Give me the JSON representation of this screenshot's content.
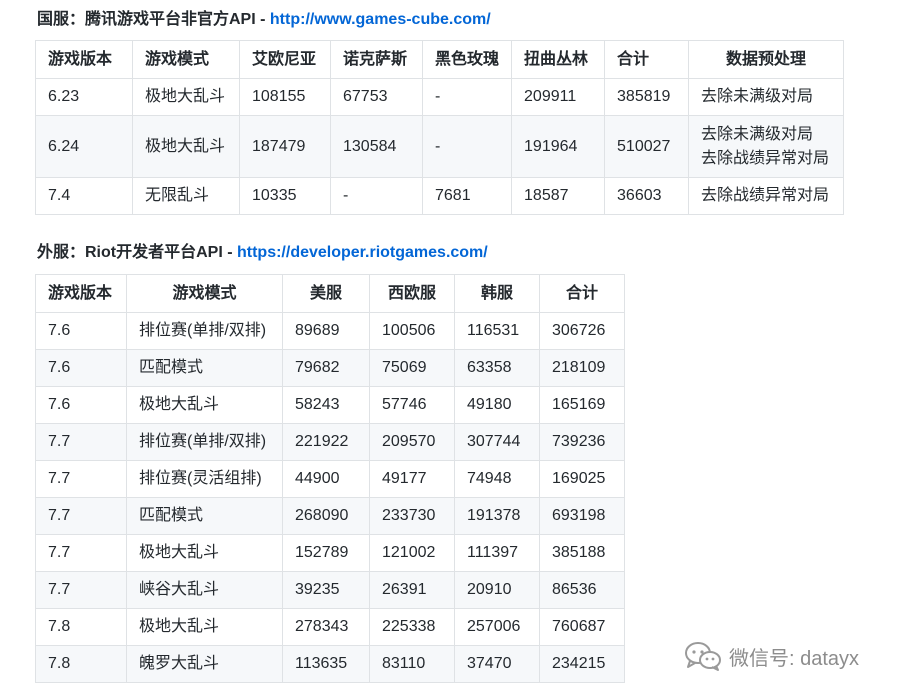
{
  "section1": {
    "label": "国服：腾讯游戏平台非官方API - ",
    "link": "http://www.games-cube.com/",
    "headers": [
      "游戏版本",
      "游戏模式",
      "艾欧尼亚",
      "诺克萨斯",
      "黑色玫瑰",
      "扭曲丛林",
      "合计",
      "数据预处理"
    ],
    "rows": [
      {
        "ver": "6.23",
        "mode": "极地大乱斗",
        "a": "108155",
        "b": "67753",
        "c": "-",
        "d": "209911",
        "e": "385819",
        "f1": "去除未满级对局",
        "f2": ""
      },
      {
        "ver": "6.24",
        "mode": "极地大乱斗",
        "a": "187479",
        "b": "130584",
        "c": "-",
        "d": "191964",
        "e": "510027",
        "f1": "去除未满级对局",
        "f2": "去除战绩异常对局"
      },
      {
        "ver": "7.4",
        "mode": "无限乱斗",
        "a": "10335",
        "b": "-",
        "c": "7681",
        "d": "18587",
        "e": "36603",
        "f1": "去除战绩异常对局",
        "f2": ""
      }
    ]
  },
  "section2": {
    "label": "外服：Riot开发者平台API - ",
    "link": "https://developer.riotgames.com/",
    "headers": [
      "游戏版本",
      "游戏模式",
      "美服",
      "西欧服",
      "韩服",
      "合计"
    ],
    "rows": [
      {
        "ver": "7.6",
        "mode": "排位赛(单排/双排)",
        "us": "89689",
        "eu": "100506",
        "kr": "116531",
        "tot": "306726"
      },
      {
        "ver": "7.6",
        "mode": "匹配模式",
        "us": "79682",
        "eu": "75069",
        "kr": "63358",
        "tot": "218109"
      },
      {
        "ver": "7.6",
        "mode": "极地大乱斗",
        "us": "58243",
        "eu": "57746",
        "kr": "49180",
        "tot": "165169"
      },
      {
        "ver": "7.7",
        "mode": "排位赛(单排/双排)",
        "us": "221922",
        "eu": "209570",
        "kr": "307744",
        "tot": "739236"
      },
      {
        "ver": "7.7",
        "mode": "排位赛(灵活组排)",
        "us": "44900",
        "eu": "49177",
        "kr": "74948",
        "tot": "169025"
      },
      {
        "ver": "7.7",
        "mode": "匹配模式",
        "us": "268090",
        "eu": "233730",
        "kr": "191378",
        "tot": "693198"
      },
      {
        "ver": "7.7",
        "mode": "极地大乱斗",
        "us": "152789",
        "eu": "121002",
        "kr": "111397",
        "tot": "385188"
      },
      {
        "ver": "7.7",
        "mode": "峡谷大乱斗",
        "us": "39235",
        "eu": "26391",
        "kr": "20910",
        "tot": "86536"
      },
      {
        "ver": "7.8",
        "mode": "极地大乱斗",
        "us": "278343",
        "eu": "225338",
        "kr": "257006",
        "tot": "760687"
      },
      {
        "ver": "7.8",
        "mode": "魄罗大乱斗",
        "us": "113635",
        "eu": "83110",
        "kr": "37470",
        "tot": "234215"
      }
    ]
  },
  "watermark": {
    "text": "微信号: datayx",
    "icon": "wechat-icon"
  },
  "colors": {
    "link": "#0366d6",
    "border": "#dfe2e5",
    "stripe": "#f6f8fa"
  }
}
